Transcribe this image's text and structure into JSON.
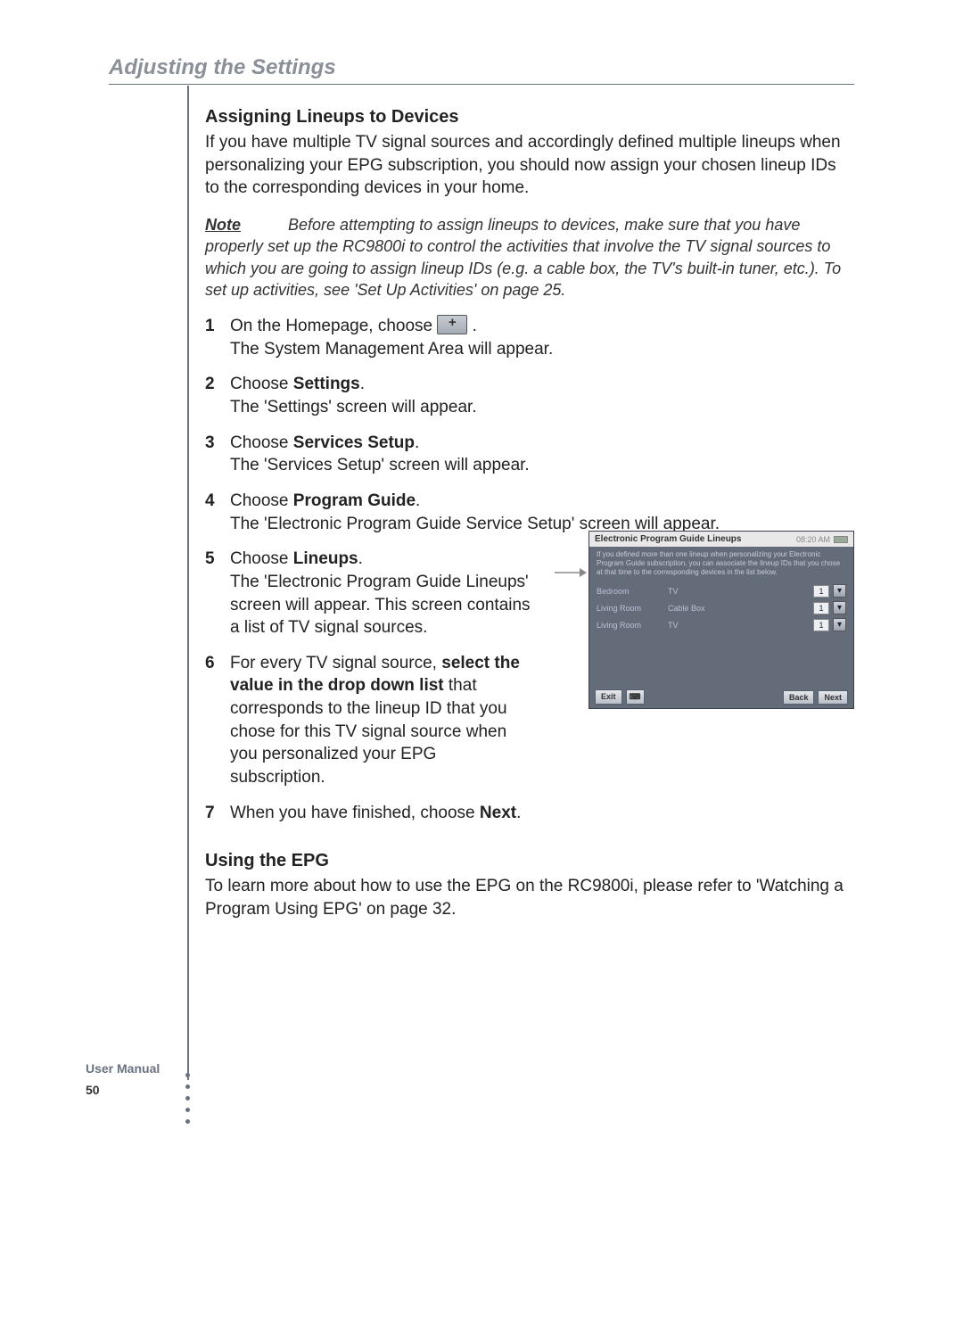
{
  "header": {
    "running_title": "Adjusting the Settings"
  },
  "section1": {
    "heading": "Assigning Lineups to Devices",
    "intro": "If you have multiple TV signal sources and accordingly defined multiple lineups when personalizing your EPG subscription, you should now assign your chosen lineup IDs to the corresponding devices in your home.",
    "note_label": "Note",
    "note_text": "Before attempting to assign lineups to devices, make sure that you have properly set up the RC9800i to control the activities that involve the TV signal sources to which you are going to assign lineup IDs (e.g. a cable box, the TV's built-in tuner, etc.). To set up activities, see 'Set Up Activities' on page 25."
  },
  "steps": [
    {
      "pre": "On the Homepage, choose ",
      "post": ".",
      "sub": "The System Management Area will appear.",
      "icon": true
    },
    {
      "pre": "Choose ",
      "bold": "Settings",
      "post": ".",
      "sub": "The 'Settings' screen will appear."
    },
    {
      "pre": "Choose ",
      "bold": "Services Setup",
      "post": ".",
      "sub": "The 'Services Setup' screen will appear."
    },
    {
      "pre": "Choose ",
      "bold": "Program Guide",
      "post": ".",
      "sub": "The 'Electronic Program Guide Service Setup' screen will appear."
    },
    {
      "pre": "Choose ",
      "bold": "Lineups",
      "post": ".",
      "sub": "The 'Electronic Program Guide Lineups' screen will appear. This screen contains a list of TV signal sources."
    },
    {
      "pre": "For every TV signal source, ",
      "bold": "select the value in the drop down list",
      "post": " that corresponds to the lineup ID that you chose for this TV signal source when you personalized your EPG subscription.",
      "sub": ""
    },
    {
      "pre": "When you have finished, choose ",
      "bold": "Next",
      "post": ".",
      "sub": ""
    }
  ],
  "screenshot": {
    "title": "Electronic Program Guide Lineups",
    "time": "08:20 AM",
    "instructions": "If you defined more than one lineup when personalizing your Electronic Program Guide subscription, you can associate the lineup IDs that you chose at that time to the corresponding devices in the list below.",
    "rows": [
      {
        "room": "Bedroom",
        "device": "TV",
        "value": "1"
      },
      {
        "room": "Living Room",
        "device": "Cable Box",
        "value": "1"
      },
      {
        "room": "Living Room",
        "device": "TV",
        "value": "1"
      }
    ],
    "buttons": {
      "exit": "Exit",
      "back": "Back",
      "next": "Next"
    }
  },
  "section2": {
    "heading": "Using the EPG",
    "body": "To learn more about how to use the EPG on the RC9800i, please refer to 'Watching a Program Using EPG' on page 32."
  },
  "footer": {
    "label": "User Manual",
    "page": "50"
  }
}
